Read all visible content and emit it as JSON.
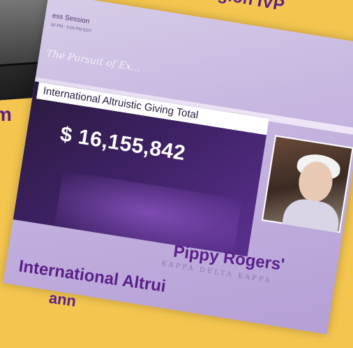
{
  "top_caption": "gion IVP",
  "left_caption": "m",
  "session": {
    "heading": "ess Session",
    "time": "00 PM - 5:00 PM EDT"
  },
  "slide": {
    "logo_script": "The Pursuit of Ex...",
    "title": "International Altruistic Giving Total",
    "value": "$ 16,155,842",
    "footer_brand": "KAPPA DELTA KAPPA"
  },
  "bottom_caption": {
    "line1": "Pippy Rogers'",
    "line2": "International Altrui",
    "line3": "ann"
  }
}
